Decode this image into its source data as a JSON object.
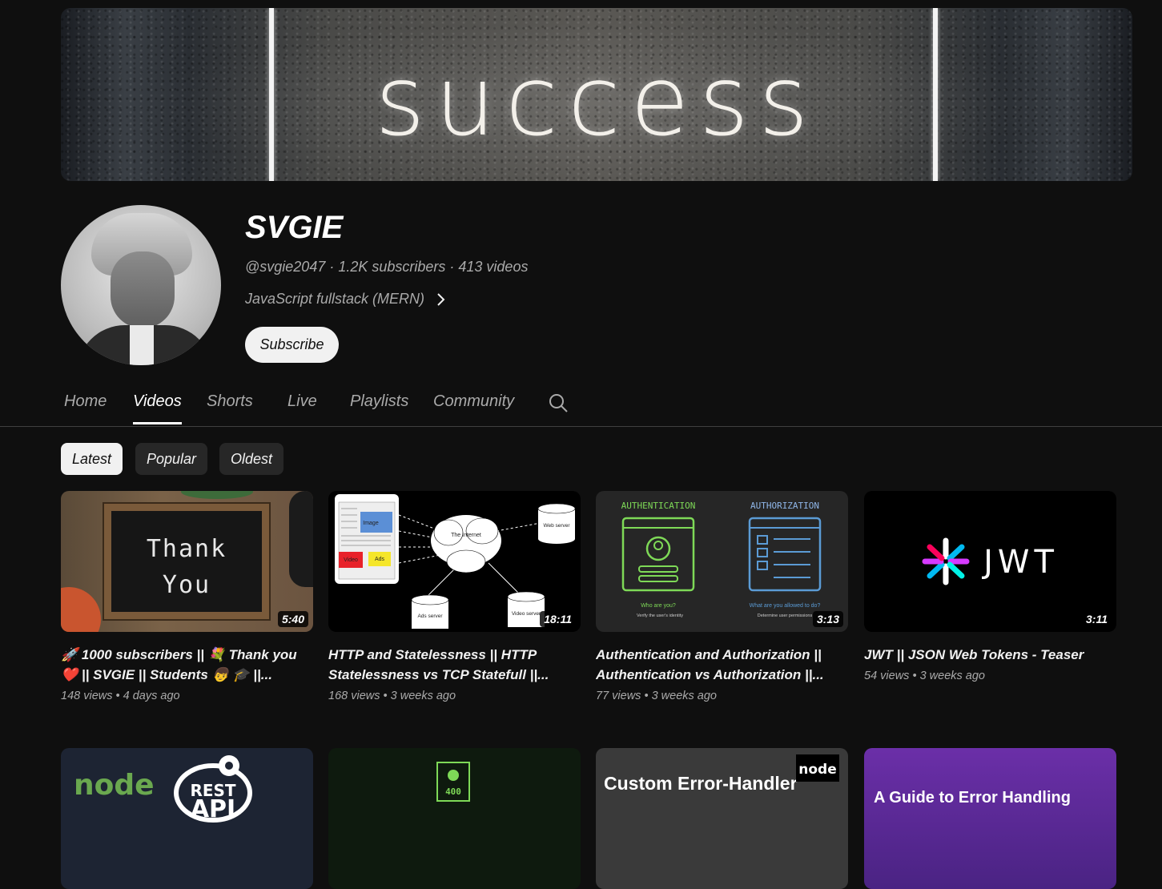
{
  "banner": {
    "word": "success"
  },
  "channel": {
    "name": "SVGIE",
    "meta": "@svgie2047 · 1.2K subscribers · 413 videos",
    "description": "JavaScript fullstack (MERN)",
    "subscribe_label": "Subscribe"
  },
  "tabs": [
    "Home",
    "Videos",
    "Shorts",
    "Live",
    "Playlists",
    "Community"
  ],
  "active_tab": "Videos",
  "chips": [
    "Latest",
    "Popular",
    "Oldest"
  ],
  "active_chip": "Latest",
  "videos": [
    {
      "title": "🚀 1000 subscribers || 💐 Thank you ❤️ || SVGIE || Students 👦 🎓 ||...",
      "views": "148 views",
      "age": "4 days ago",
      "duration": "5:40",
      "thumb_text": [
        "Thank",
        "You"
      ]
    },
    {
      "title": "HTTP and Statelessness || HTTP Statelessness vs TCP Statefull ||...",
      "views": "168 views",
      "age": "3 weeks ago",
      "duration": "18:11",
      "thumb_text": [
        "Image",
        "Video",
        "Ads",
        "The Internet",
        "Web server",
        "Ads server",
        "Video server"
      ]
    },
    {
      "title": "Authentication and Authorization || Authentication vs Authorization ||...",
      "views": "77 views",
      "age": "3 weeks ago",
      "duration": "3:13",
      "thumb_text": [
        "AUTHENTICATION",
        "AUTHORIZATION",
        "Who are you?",
        "Verify the user's identity",
        "What are you allowed to do?",
        "Determine user permissions"
      ]
    },
    {
      "title": "JWT || JSON Web Tokens - Teaser",
      "views": "54 views",
      "age": "3 weeks ago",
      "duration": "3:11",
      "thumb_text": [
        "JWT"
      ]
    },
    {
      "thumb_text": [
        "node",
        "REST",
        "API"
      ]
    },
    {
      "thumb_text": [
        "400"
      ]
    },
    {
      "thumb_text": [
        "Custom Error-Handler",
        "node"
      ]
    },
    {
      "thumb_text": [
        "A Guide to Error Handling"
      ]
    }
  ],
  "colors": {
    "background": "#0f0f0f",
    "text": "#f1f1f1",
    "secondary_text": "#aaaaaa",
    "chip": "#272727"
  }
}
